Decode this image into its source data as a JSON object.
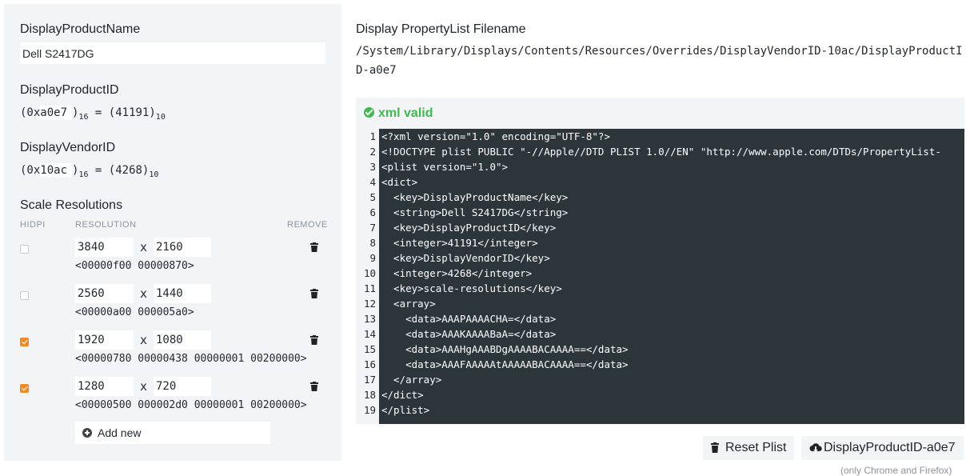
{
  "left": {
    "product_name_label": "DisplayProductName",
    "product_name_value": "Dell S2417DG",
    "product_id_label": "DisplayProductID",
    "product_id_hex_prefix": "(0x",
    "product_id_hex": "a0e7",
    "product_id_base16": "16",
    "product_id_equals": " = (41191)",
    "product_id_base10": "10",
    "vendor_id_label": "DisplayVendorID",
    "vendor_id_hex_prefix": "(0x",
    "vendor_id_hex": "10ac",
    "vendor_id_base16": "16",
    "vendor_id_equals": " = (4268)",
    "vendor_id_base10": "10",
    "scale_label": "Scale Resolutions",
    "col_hidpi": "HIDPI",
    "col_resolution": "RESOLUTION",
    "col_remove": "REMOVE",
    "resolutions": [
      {
        "width": "3840",
        "height": "2160",
        "hidpi": false,
        "hex": "<00000f00 00000870>"
      },
      {
        "width": "2560",
        "height": "1440",
        "hidpi": false,
        "hex": "<00000a00 000005a0>"
      },
      {
        "width": "1920",
        "height": "1080",
        "hidpi": true,
        "hex": "<00000780 00000438 00000001 00200000>"
      },
      {
        "width": "1280",
        "height": "720",
        "hidpi": true,
        "hex": "<00000500 000002d0 00000001 00200000>"
      }
    ],
    "x_sep": "x",
    "add_new": "Add new"
  },
  "right": {
    "filename_label": "Display PropertyList Filename",
    "filename": "/System/Library/Displays/Contents/Resources/Overrides/DisplayVendorID-10ac/DisplayProductID-a0e7",
    "valid_text": "xml valid",
    "code_lines": [
      "<?xml version=\"1.0\" encoding=\"UTF-8\"?>",
      "<!DOCTYPE plist PUBLIC \"-//Apple//DTD PLIST 1.0//EN\" \"http://www.apple.com/DTDs/PropertyList-",
      "<plist version=\"1.0\">",
      "<dict>",
      "  <key>DisplayProductName</key>",
      "  <string>Dell S2417DG</string>",
      "  <key>DisplayProductID</key>",
      "  <integer>41191</integer>",
      "  <key>DisplayVendorID</key>",
      "  <integer>4268</integer>",
      "  <key>scale-resolutions</key>",
      "  <array>",
      "    <data>AAAPAAAACHA=</data>",
      "    <data>AAAKAAAABaA=</data>",
      "    <data>AAAHgAAABDgAAAABACAAAA==</data>",
      "    <data>AAAFAAAAAtAAAAABACAAAA==</data>",
      "  </array>",
      "</dict>",
      "</plist>"
    ],
    "line_numbers": [
      "1",
      "2",
      "3",
      "4",
      "5",
      "6",
      "7",
      "8",
      "9",
      "10",
      "11",
      "12",
      "13",
      "14",
      "15",
      "16",
      "17",
      "18",
      "19"
    ],
    "reset_label": "Reset Plist",
    "download_label": "DisplayProductID-a0e7",
    "note": "(only Chrome and Firefox)"
  },
  "colors": {
    "accent": "#f08a24",
    "valid": "#3fb950",
    "code_bg": "#2b353a",
    "panel_bg": "#f3f4f6"
  }
}
